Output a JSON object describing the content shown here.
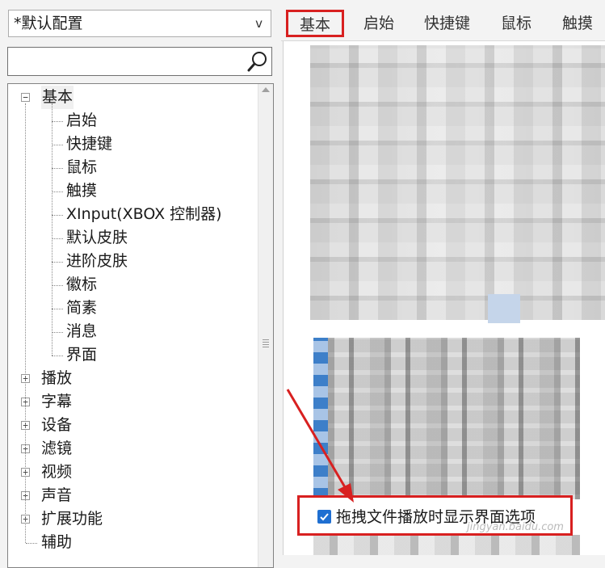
{
  "profile": {
    "selected": "*默认配置",
    "chevron": "v"
  },
  "search": {
    "value": "",
    "placeholder": ""
  },
  "tree": {
    "root": {
      "label": "基本",
      "expander": "−"
    },
    "children": [
      "启始",
      "快捷键",
      "鼠标",
      "触摸",
      "XInput(XBOX 控制器)",
      "默认皮肤",
      "进阶皮肤",
      "徽标",
      "简素",
      "消息",
      "界面"
    ],
    "sections": [
      "播放",
      "字幕",
      "设备",
      "滤镜",
      "视频",
      "声音",
      "扩展功能"
    ],
    "last": "辅助",
    "collapsed_expander": "+"
  },
  "tabs": [
    "基本",
    "启始",
    "快捷键",
    "鼠标",
    "触摸"
  ],
  "option": {
    "label": "拖拽文件播放时显示界面选项",
    "checked": true
  },
  "watermark": {
    "text": "jingyan.baidu.com"
  },
  "colors": {
    "annotation": "#d82020",
    "check": "#1f6fd1"
  }
}
